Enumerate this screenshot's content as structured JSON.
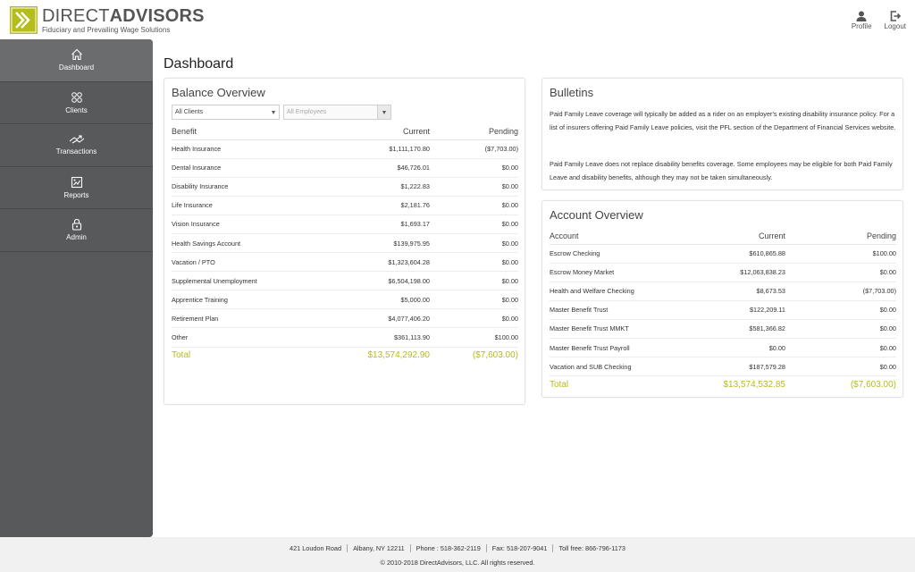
{
  "brand": {
    "name_thin": "DIRECT",
    "name_bold": "ADVISORS",
    "tagline": "Fiduciary and Prevailing Wage Solutions",
    "accent": "#b5bd1a"
  },
  "header_actions": [
    {
      "label": "Profile",
      "icon": "user-icon"
    },
    {
      "label": "Logout",
      "icon": "logout-icon"
    }
  ],
  "sidebar": {
    "items": [
      {
        "label": "Dashboard",
        "icon": "home-icon",
        "active": true
      },
      {
        "label": "Clients",
        "icon": "clients-icon"
      },
      {
        "label": "Transactions",
        "icon": "transactions-icon"
      },
      {
        "label": "Reports",
        "icon": "reports-icon"
      },
      {
        "label": "Admin",
        "icon": "lock-icon"
      }
    ]
  },
  "page_title": "Dashboard",
  "balance_overview": {
    "title": "Balance Overview",
    "client_filter": "All Clients",
    "employee_filter": "All Employees",
    "headers": [
      "Benefit",
      "Current",
      "Pending"
    ],
    "rows": [
      [
        "Health Insurance",
        "$1,111,170.80",
        "($7,703.00)"
      ],
      [
        "Dental Insurance",
        "$46,726.01",
        "$0.00"
      ],
      [
        "Disability Insurance",
        "$1,222.83",
        "$0.00"
      ],
      [
        "Life Insurance",
        "$2,181.76",
        "$0.00"
      ],
      [
        "Vision Insurance",
        "$1,693.17",
        "$0.00"
      ],
      [
        "Health Savings Account",
        "$139,975.95",
        "$0.00"
      ],
      [
        "Vacation / PTO",
        "$1,323,604.28",
        "$0.00"
      ],
      [
        "Supplemental Unemployment",
        "$6,504,198.00",
        "$0.00"
      ],
      [
        "Apprentice Training",
        "$5,000.00",
        "$0.00"
      ],
      [
        "Retirement Plan",
        "$4,077,406.20",
        "$0.00"
      ],
      [
        "Other",
        "$361,113.90",
        "$100.00"
      ]
    ],
    "total": [
      "Total",
      "$13,574,292.90",
      "($7,603.00)"
    ]
  },
  "bulletins": {
    "title": "Bulletins",
    "paragraphs": [
      "Paid Family Leave coverage will typically be added as a rider on an employer's existing disability insurance policy. For a list of insurers offering Paid Family Leave policies, visit the PFL section of the Department of Financial Services website.",
      "Paid Family Leave does not replace disability benefits coverage. Some employees may be eligible for both Paid Family Leave and disability benefits, although they may not be taken simultaneously."
    ]
  },
  "account_overview": {
    "title": "Account Overview",
    "headers": [
      "Account",
      "Current",
      "Pending"
    ],
    "rows": [
      [
        "Escrow Checking",
        "$610,865.88",
        "$100.00"
      ],
      [
        "Escrow Money Market",
        "$12,063,838.23",
        "$0.00"
      ],
      [
        "Health and Welfare Checking",
        "$8,673.53",
        "($7,703.00)"
      ],
      [
        "Master Benefit Trust",
        "$122,209.11",
        "$0.00"
      ],
      [
        "Master Benefit Trust MMKT",
        "$581,366.82",
        "$0.00"
      ],
      [
        "Master Benefit Trust Payroll",
        "$0.00",
        "$0.00"
      ],
      [
        "Vacation and SUB Checking",
        "$187,579.28",
        "$0.00"
      ]
    ],
    "total": [
      "Total",
      "$13,574,532.85",
      "($7,603.00)"
    ]
  },
  "footer": {
    "items": [
      "421 Loudon Road",
      "Albany, NY 12211",
      "Phone : 518-362-2119",
      "Fax: 518-207-9041",
      "Toll free: 866-796-1173"
    ],
    "copyright": "© 2010-2018 DirectAdvisors, LLC. All rights reserved."
  }
}
